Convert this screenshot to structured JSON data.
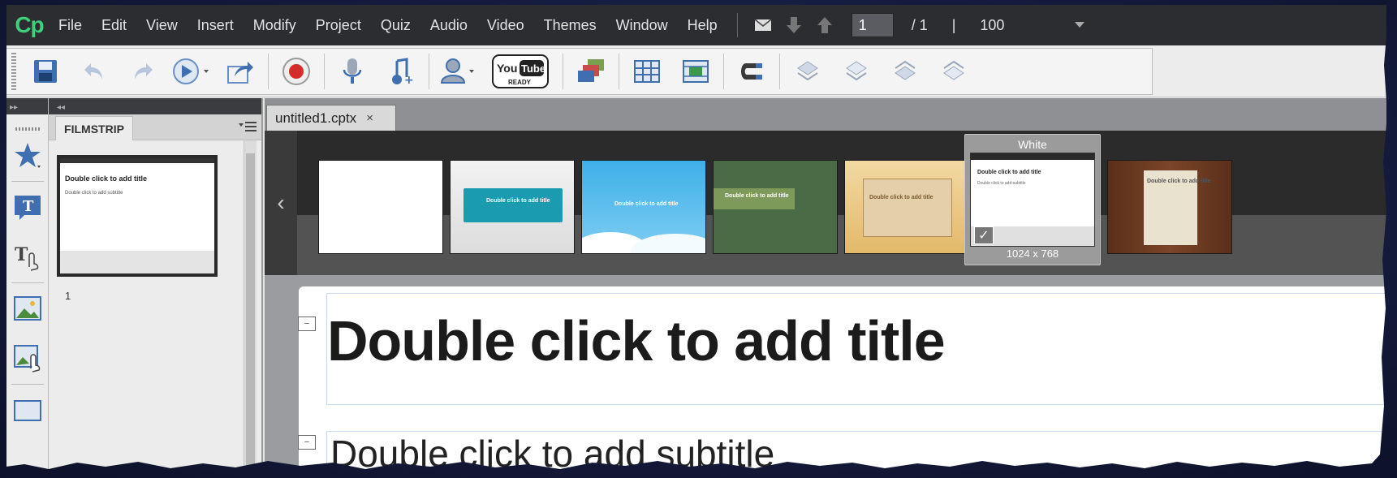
{
  "app": {
    "logo": "Cp"
  },
  "menubar": {
    "items": [
      "File",
      "Edit",
      "View",
      "Insert",
      "Modify",
      "Project",
      "Quiz",
      "Audio",
      "Video",
      "Themes",
      "Window",
      "Help"
    ],
    "page_current": "1",
    "page_total": "/ 1",
    "divider": "|",
    "zoom": "100"
  },
  "toolbar": {
    "youtube_top": "You Tube",
    "youtube_bottom": "READY"
  },
  "filmstrip": {
    "tab_label": "FILMSTRIP",
    "slide_title": "Double click to add title",
    "slide_subtitle": "Double click to add subtitle",
    "slide_number": "1"
  },
  "document": {
    "tab_label": "untitled1.cptx",
    "tab_close": "×"
  },
  "themes": {
    "items": [
      {
        "name": "blank",
        "caption": ""
      },
      {
        "name": "teal",
        "caption": "Double click to add title"
      },
      {
        "name": "sky",
        "caption": "Double click to add title"
      },
      {
        "name": "green",
        "caption": "Double click to add title"
      },
      {
        "name": "parchment",
        "caption": "Double click to add title"
      },
      {
        "name": "white",
        "caption": "Double click to add title"
      },
      {
        "name": "wood",
        "caption": "Double click to add title"
      }
    ],
    "selected": {
      "name": "White",
      "dimensions": "1024 x 768",
      "subtitle": "Double click to add subtitle"
    },
    "colors": {
      "accent_green": "#3fd07b",
      "teal": "#1a9bb0",
      "sky": "#3eb0e8",
      "green": "#4b6b47",
      "parchment": "#e9c98a",
      "wood": "#6b3a22"
    }
  },
  "stage": {
    "title_placeholder": "Double click to add title",
    "subtitle_placeholder": "Double click to add subtitle"
  }
}
